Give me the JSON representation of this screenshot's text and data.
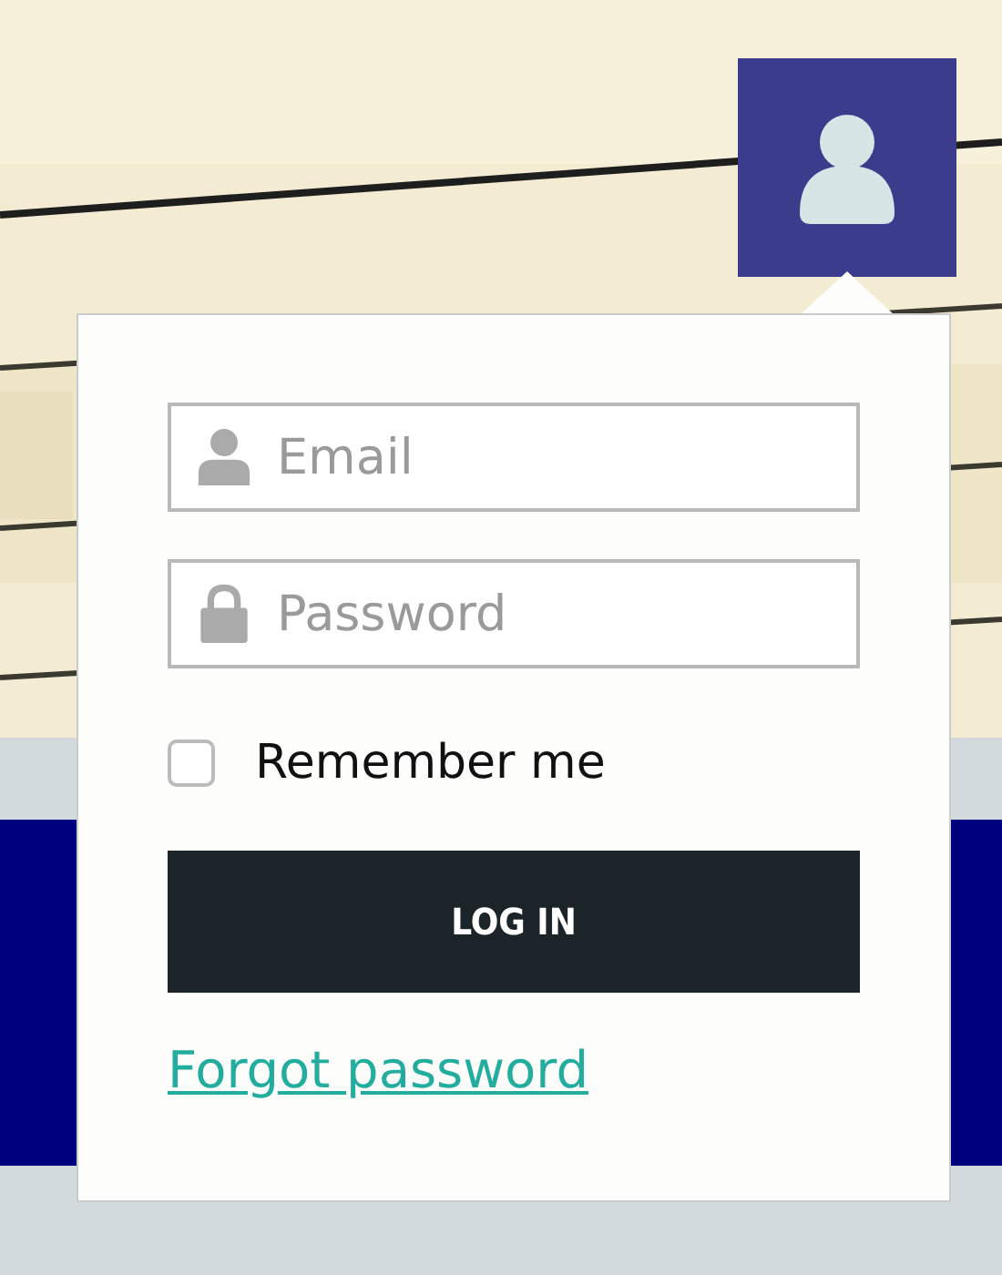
{
  "login_form": {
    "email": {
      "placeholder": "Email"
    },
    "password": {
      "placeholder": "Password"
    },
    "remember": {
      "label": "Remember me",
      "checked": false
    },
    "submit": {
      "label": "LOG IN"
    },
    "forgot_link": {
      "label": "Forgot password"
    }
  }
}
